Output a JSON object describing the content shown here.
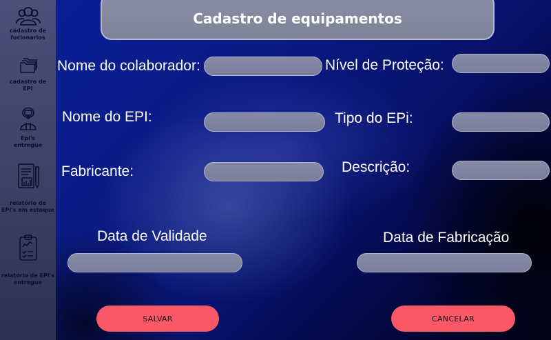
{
  "title": "Cadastro de equipamentos",
  "sidebar": {
    "items": [
      {
        "label": "cadastro de\nfucionarios",
        "icon": "users-icon"
      },
      {
        "label": "cadastro de\nEPI",
        "icon": "folders-icon"
      },
      {
        "label": "Epi's\nentregue",
        "icon": "hazmat-worker-icon"
      },
      {
        "label": "relatório de\nEPI's em estoque",
        "icon": "report-chart-icon"
      },
      {
        "label": "relatório de EPI's\nentregue",
        "icon": "clipboard-checklist-icon"
      }
    ]
  },
  "form": {
    "nome_colaborador": {
      "label": "Nome do colaborador:",
      "value": ""
    },
    "nivel_protecao": {
      "label": "Nível de Proteção:",
      "value": ""
    },
    "nome_epi": {
      "label": "Nome do EPI:",
      "value": ""
    },
    "tipo_epi": {
      "label": "Tipo do EPi:",
      "value": ""
    },
    "fabricante": {
      "label": "Fabricante:",
      "value": ""
    },
    "descricao": {
      "label": "Descrição:",
      "value": ""
    },
    "data_validade": {
      "label": "Data de Validade",
      "value": ""
    },
    "data_fabricacao": {
      "label": "Data de Fabricação",
      "value": ""
    }
  },
  "buttons": {
    "save_label": "SALVAR",
    "cancel_label": "CANCELAR"
  },
  "colors": {
    "accent_button": "#f95866",
    "sidebar": "#3f4468",
    "field": "#7f849f"
  }
}
